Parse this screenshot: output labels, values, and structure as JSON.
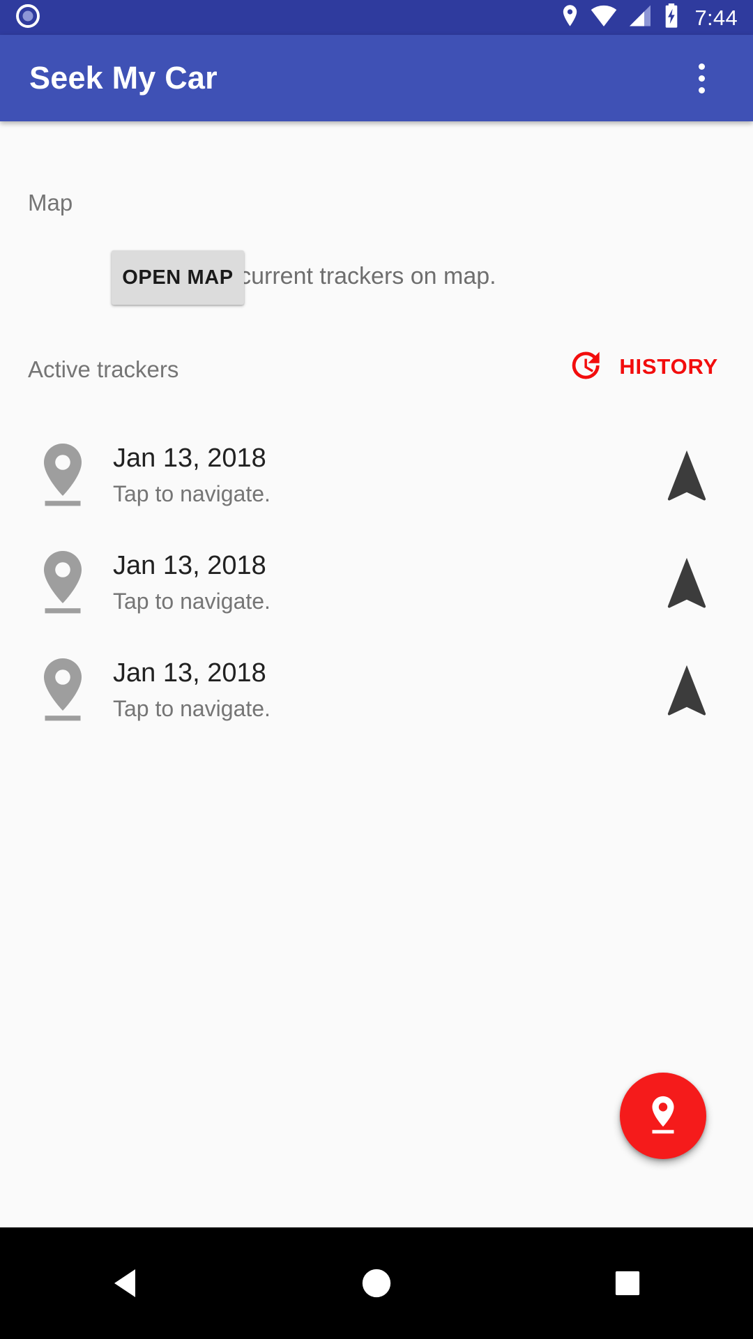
{
  "status_bar": {
    "time": "7:44",
    "icons": [
      "record-icon",
      "location-icon",
      "wifi-icon",
      "cell-signal-icon",
      "battery-charging-icon"
    ],
    "background_color": "#2F3B9E"
  },
  "app_bar": {
    "title": "Seek My Car",
    "overflow_menu_icon": "more-vert-icon",
    "background_color": "#3F51B5",
    "title_color": "#FFFFFF"
  },
  "map_section": {
    "label": "Map",
    "description": "View your current trackers on map.",
    "button_label": "OPEN MAP",
    "button_color": "#DCDCDC"
  },
  "trackers_section": {
    "label": "Active trackers",
    "history_label": "HISTORY",
    "history_icon": "history-clock-icon",
    "history_color": "#F20D0D",
    "items": [
      {
        "title": "Jan 13, 2018",
        "subtitle": "Tap to navigate.",
        "leading_icon": "map-pin-icon",
        "trailing_icon": "navigation-arrow-icon"
      },
      {
        "title": "Jan 13, 2018",
        "subtitle": "Tap to navigate.",
        "leading_icon": "map-pin-icon",
        "trailing_icon": "navigation-arrow-icon"
      },
      {
        "title": "Jan 13, 2018",
        "subtitle": "Tap to navigate.",
        "leading_icon": "map-pin-icon",
        "trailing_icon": "navigation-arrow-icon"
      }
    ]
  },
  "fab": {
    "icon": "add-location-pin-icon",
    "color": "#F51B1B"
  },
  "nav_bar": {
    "back_icon": "back-triangle-icon",
    "home_icon": "home-circle-icon",
    "recents_icon": "recents-square-icon",
    "background_color": "#000000"
  }
}
